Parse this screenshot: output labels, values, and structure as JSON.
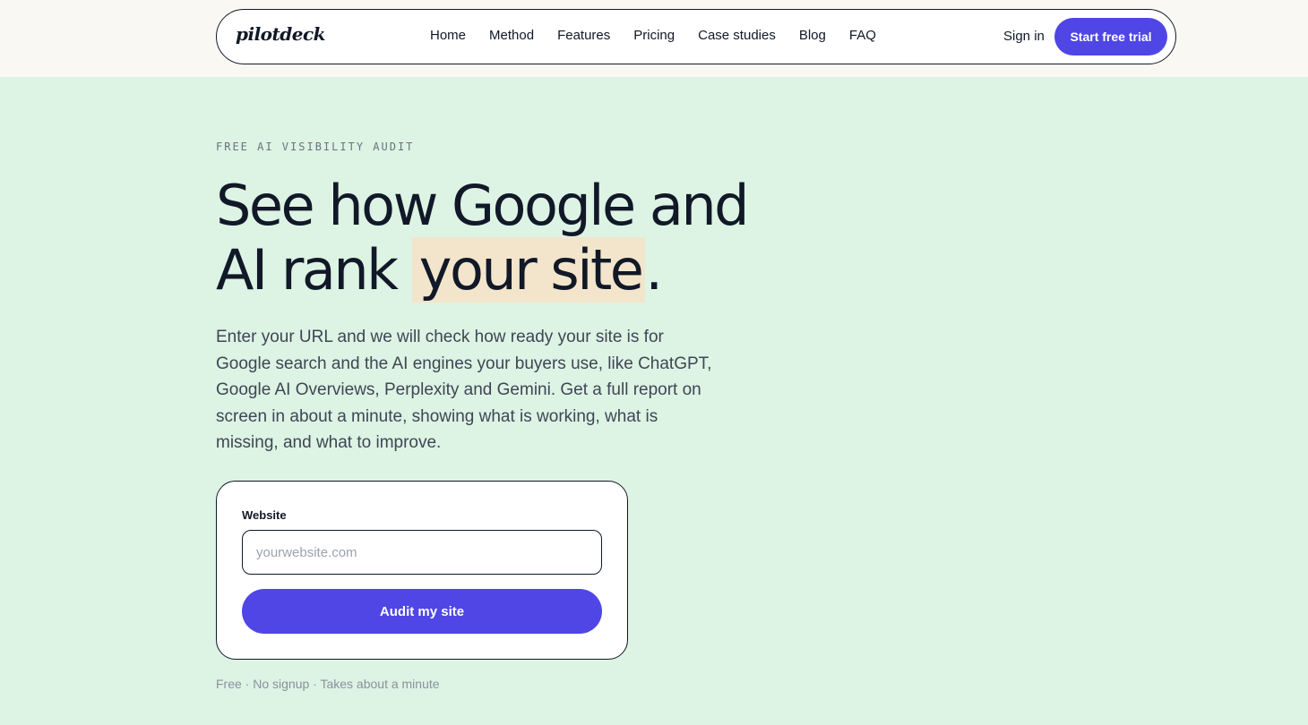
{
  "brand": {
    "logo": "pilotdeck"
  },
  "nav": {
    "links": [
      "Home",
      "Method",
      "Features",
      "Pricing",
      "Case studies",
      "Blog",
      "FAQ"
    ],
    "signin": "Sign in",
    "cta": "Start free trial"
  },
  "hero": {
    "eyebrow": "FREE AI VISIBILITY AUDIT",
    "headline_line1": "See how Google and",
    "headline_prefix": "AI rank ",
    "headline_highlight": "your site",
    "headline_suffix": ".",
    "intro": "Enter your URL and we will check how ready your site is for Google search and the AI engines your buyers use, like ChatGPT, Google AI Overviews, Perplexity and Gemini. Get a full report on screen in about a minute, showing what is working, what is missing, and what to improve."
  },
  "form": {
    "label": "Website",
    "placeholder": "yourwebsite.com",
    "value": "",
    "submit": "Audit my site"
  },
  "footnote": "Free · No signup · Takes about a minute",
  "colors": {
    "accent": "#4f46e5",
    "hero_bg": "#ddf3e4",
    "topbar_bg": "#faf8f3",
    "highlight": "#f2e5cc"
  }
}
